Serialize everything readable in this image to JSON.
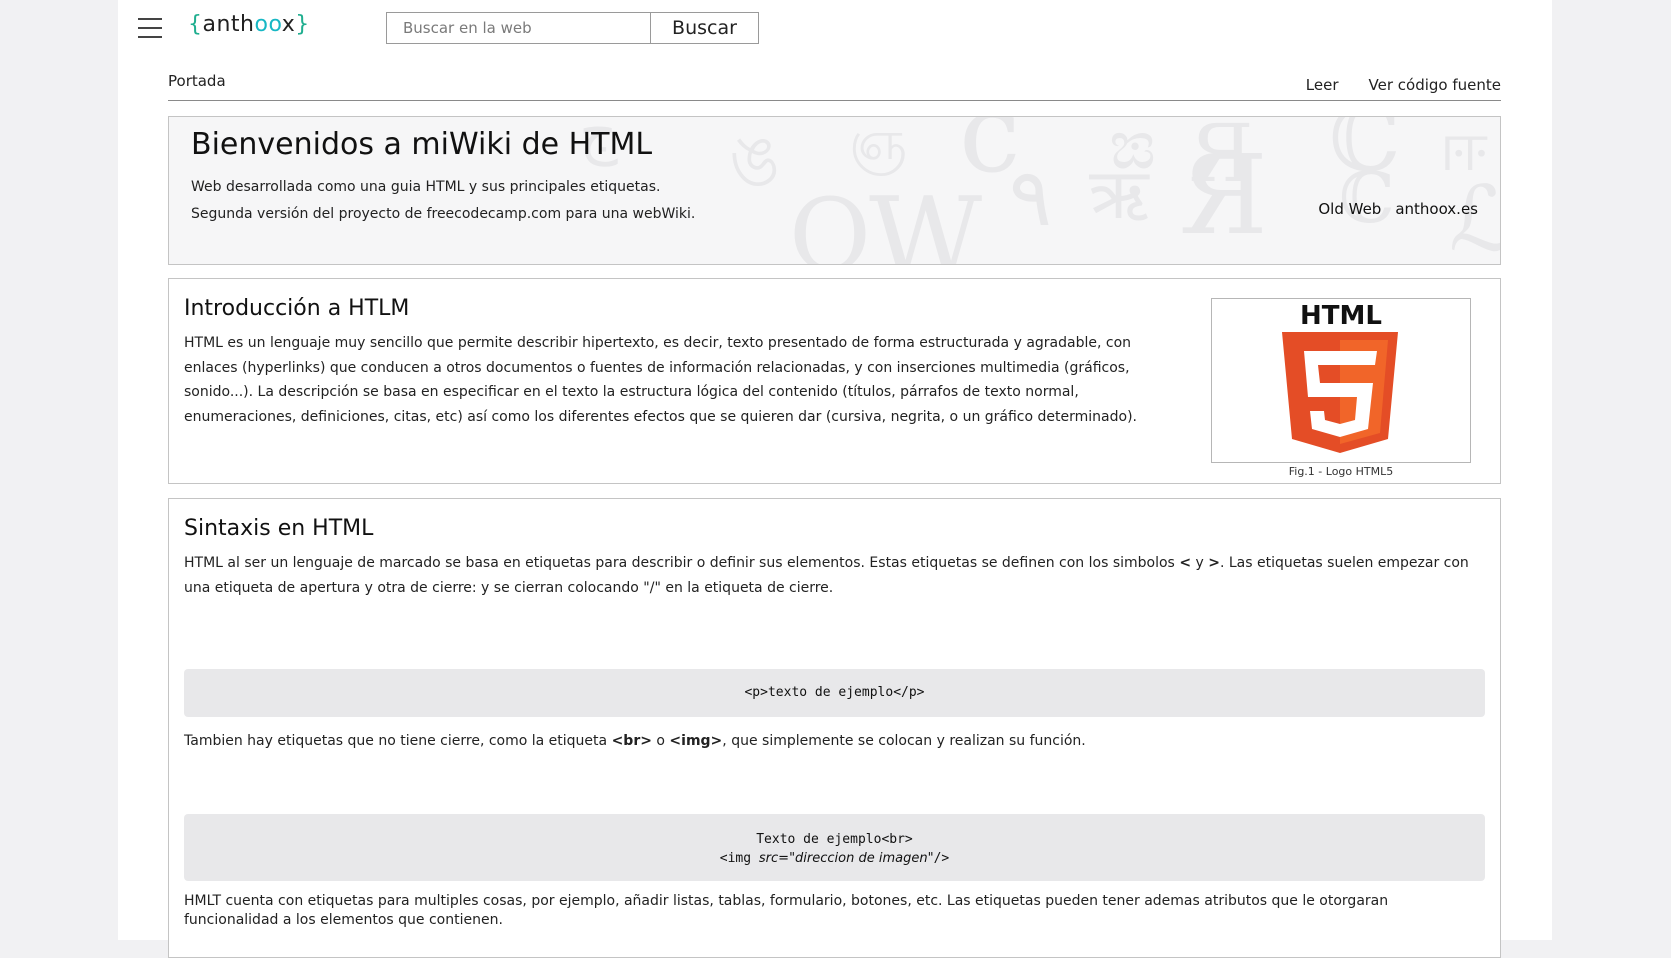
{
  "header": {
    "logo_open": "{",
    "logo_pre": "anth",
    "logo_oo": "oo",
    "logo_post": "x",
    "logo_close": "}",
    "search_placeholder": "Buscar en la web",
    "search_button": "Buscar"
  },
  "nav": {
    "breadcrumb": "Portada",
    "tabs": [
      "Leer",
      "Ver código fuente"
    ]
  },
  "hero": {
    "title": "Bienvenidos a miWiki de HTML",
    "line1": "Web desarrollada como una guia HTML y sus principales etiquetas.",
    "line2": "Segunda versión del proyecto de freecodecamp.com para una webWiki.",
    "links": [
      "Old Web",
      "anthoox.es"
    ]
  },
  "intro": {
    "title": "Introducción a HTLM",
    "body": "HTML es un lenguaje muy sencillo que permite describir hipertexto, es decir, texto presentado de forma estructurada y agradable, con enlaces (hyperlinks) que conducen a otros documentos o fuentes de información relacionadas, y con inserciones multimedia (gráficos, sonido...). La descripción se basa en especificar en el texto la estructura lógica del contenido (títulos, párrafos de texto normal, enumeraciones, definiciones, citas, etc) así como los diferentes efectos que se quieren dar (cursiva, negrita, o un gráfico determinado).",
    "figure_title": "HTML",
    "figure_glyph": "5",
    "figure_caption": "Fig.1 - Logo HTML5"
  },
  "syntax": {
    "title": "Sintaxis en HTML",
    "p1_a": "HTML al ser un lenguaje de marcado se basa en etiquetas para describir o definir sus elementos. Estas etiquetas se definen con los simbolos ",
    "p1_lt": "<",
    "p1_y": " y ",
    "p1_gt": ">",
    "p1_b": ". Las etiquetas suelen empezar con una etiqueta de apertura y otra de cierre: y se cierran colocando \"/\" en la etiqueta de cierre.",
    "code1": "<p>texto de ejemplo</p>",
    "p2_a": "Tambien hay etiquetas que no tiene cierre, como la etiqueta ",
    "p2_br": "<br>",
    "p2_o": " o ",
    "p2_img": "<img>",
    "p2_b": ", que simplemente se colocan y realizan su función.",
    "code2_line1": "Texto de ejemplo<br>",
    "code2_line2_tag": "<img ",
    "code2_line2_attr": "src=\"direccion de imagen\"",
    "code2_line2_end": "/>",
    "p3": "HMLT cuenta con etiquetas para multiples cosas, por ejemplo, añadir listas, tablas, formulario, botones, etc. Las etiquetas pueden tener ademas atributos que le otorgaran funcionalidad a los elementos que contienen."
  },
  "colors": {
    "html5_orange": "#e44d26",
    "html5_orange_light": "#f16529",
    "code_bg": "#e8e8ea",
    "logo_accent": "#17b7c4"
  }
}
